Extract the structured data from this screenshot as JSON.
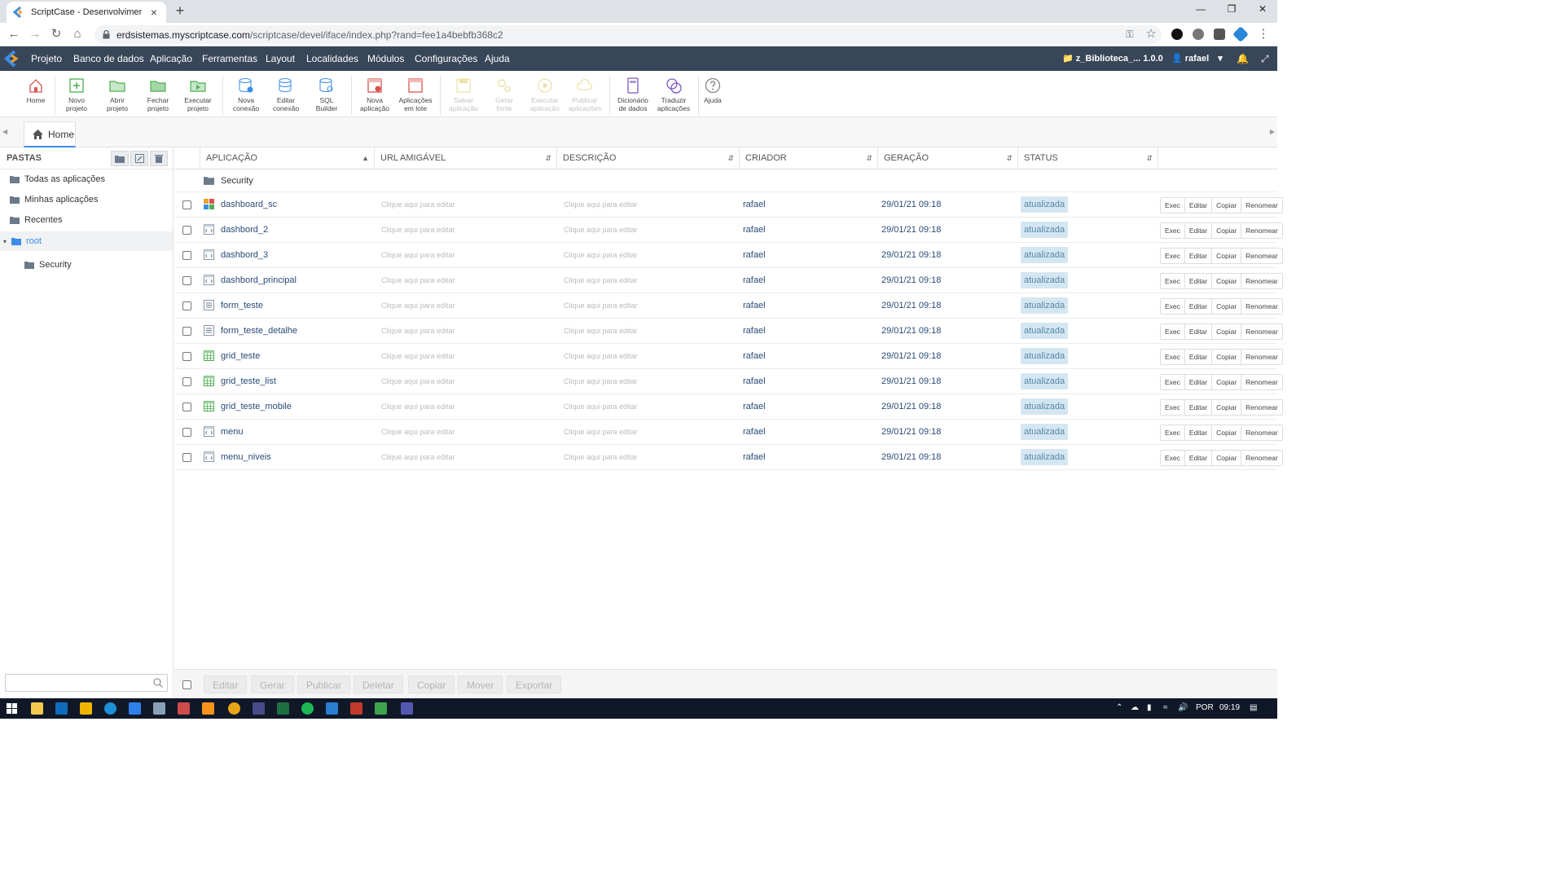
{
  "browser": {
    "tab_title": "ScriptCase - Desenvolvimento - ",
    "tab_close": "×",
    "new_tab": "+",
    "url_host": "erdsistemas.myscriptcase.com",
    "url_path": "/scriptcase/devel/iface/index.php?rand=fee1a4bebfb368c2"
  },
  "menu": {
    "items": [
      "Projeto",
      "Banco de dados",
      "Aplicação",
      "Ferramentas",
      "Layout",
      "Localidades",
      "Módulos",
      "Configurações",
      "Ajuda"
    ],
    "project": "z_Biblioteca_... 1.0.0",
    "user": "rafael"
  },
  "toolbar": [
    {
      "label": "Home",
      "icon": "home-icon"
    },
    {
      "label": "Novo\nprojeto",
      "icon": "new-project-icon"
    },
    {
      "label": "Abrir\nprojeto",
      "icon": "open-folder-icon"
    },
    {
      "label": "Fechar\nprojeto",
      "icon": "close-folder-icon"
    },
    {
      "label": "Executar\nprojeto",
      "icon": "run-project-icon"
    },
    {
      "label": "Nova\nconexão",
      "icon": "new-connection-icon"
    },
    {
      "label": "Editar\nconexão",
      "icon": "edit-connection-icon"
    },
    {
      "label": "SQL\nBuilder",
      "icon": "sql-builder-icon"
    },
    {
      "label": "Nova\naplicação",
      "icon": "new-app-icon"
    },
    {
      "label": "Aplicações\nem lote",
      "icon": "batch-apps-icon"
    },
    {
      "label": "Salvar\naplicação",
      "icon": "save-icon"
    },
    {
      "label": "Gerar\nfonte",
      "icon": "generate-source-icon"
    },
    {
      "label": "Executar\naplicação",
      "icon": "run-app-icon"
    },
    {
      "label": "Publicar\naplicações",
      "icon": "publish-icon"
    },
    {
      "label": "Dicionário\nde dados",
      "icon": "dictionary-icon"
    },
    {
      "label": "Traduzir\naplicações",
      "icon": "translate-icon"
    },
    {
      "label": "Ajuda",
      "icon": "help-icon"
    }
  ],
  "home_tab": "Home",
  "sidebar": {
    "title": "PASTAS",
    "folders": [
      "Todas as aplicações",
      "Minhas aplicações",
      "Recentes",
      "root",
      "Security"
    ]
  },
  "table": {
    "headers": [
      "APLICAÇÃO",
      "URL AMIGÁVEL",
      "DESCRIÇÃO",
      "CRIADOR",
      "GERAÇÃO",
      "STATUS"
    ],
    "folder_row": "Security",
    "placeholder": "Clique aqui para editar",
    "actions": [
      "Exec",
      "Editar",
      "Copiar",
      "Renomear"
    ],
    "rows": [
      {
        "name": "dashboard_sc",
        "type": "dashboard",
        "creator": "rafael",
        "generated": "29/01/21 09:18",
        "status": "atualizada"
      },
      {
        "name": "dashbord_2",
        "type": "code",
        "creator": "rafael",
        "generated": "29/01/21 09:18",
        "status": "atualizada"
      },
      {
        "name": "dashbord_3",
        "type": "code",
        "creator": "rafael",
        "generated": "29/01/21 09:18",
        "status": "atualizada"
      },
      {
        "name": "dashbord_principal",
        "type": "code",
        "creator": "rafael",
        "generated": "29/01/21 09:18",
        "status": "atualizada"
      },
      {
        "name": "form_teste",
        "type": "form",
        "creator": "rafael",
        "generated": "29/01/21 09:18",
        "status": "atualizada"
      },
      {
        "name": "form_teste_detalhe",
        "type": "form",
        "creator": "rafael",
        "generated": "29/01/21 09:18",
        "status": "atualizada"
      },
      {
        "name": "grid_teste",
        "type": "grid",
        "creator": "rafael",
        "generated": "29/01/21 09:18",
        "status": "atualizada"
      },
      {
        "name": "grid_teste_list",
        "type": "grid",
        "creator": "rafael",
        "generated": "29/01/21 09:18",
        "status": "atualizada"
      },
      {
        "name": "grid_teste_mobile",
        "type": "grid",
        "creator": "rafael",
        "generated": "29/01/21 09:18",
        "status": "atualizada"
      },
      {
        "name": "menu",
        "type": "code",
        "creator": "rafael",
        "generated": "29/01/21 09:18",
        "status": "atualizada"
      },
      {
        "name": "menu_niveis",
        "type": "code",
        "creator": "rafael",
        "generated": "29/01/21 09:18",
        "status": "atualizada"
      }
    ]
  },
  "bottom_buttons": [
    "Editar",
    "Gerar",
    "Publicar",
    "Deletar",
    "Copiar",
    "Mover",
    "Exportar"
  ],
  "taskbar": {
    "lang": "POR",
    "time": "09:19"
  },
  "colors": {
    "menubar": "#384659",
    "accent": "#3a8ee6",
    "status_bg": "#d4e6f1",
    "status_text": "#5687a6",
    "link": "#294a77"
  }
}
